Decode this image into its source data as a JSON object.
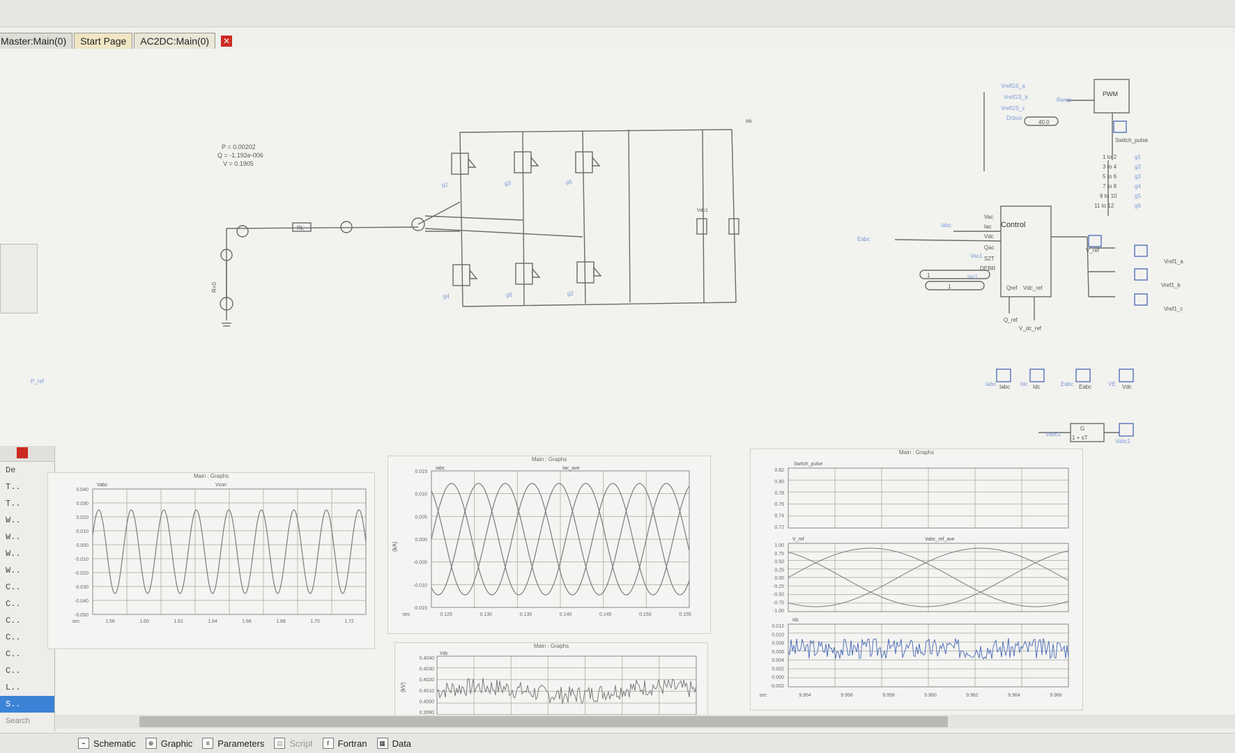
{
  "tabs": [
    "Master:Main(0)",
    "Start Page",
    "AC2DC:Main(0)"
  ],
  "schematic": {
    "pq": [
      "P = 0.00202",
      "Q = -1.192e-006",
      "V = 0.1905"
    ],
    "rl_label": "RL",
    "source_label": "R=0",
    "dc_label": "Vdc1",
    "dc_current": "Idc",
    "gate_labels": [
      "g1",
      "g3",
      "g5",
      "g4",
      "g6",
      "g2"
    ],
    "legs": [
      "2",
      "2",
      "2",
      "2",
      "2",
      "2"
    ],
    "control_block": "Control",
    "control_inputs": [
      "Vac",
      "Iac",
      "Vdc",
      "Qac",
      "S2T",
      "DEBR"
    ],
    "control_outputs": [
      "Qref",
      "Vdc_ref"
    ],
    "control_refs": [
      "Q_ref",
      "V_dc_ref"
    ],
    "control_out_labels": [
      "V_ref",
      "Vref1_a",
      "Vref1_b",
      "Vref1_c"
    ],
    "control_out_right": [
      "Vref1_a",
      "Vref1_b",
      "Vref1_c"
    ],
    "pwm_block": "PWM",
    "pwm_inputs": [
      "VrefGS_a",
      "VrefGS_b",
      "VrefGS_c",
      "Dcbus"
    ],
    "pwm_const": "40.0",
    "pwm_ramp": "Ramp",
    "switch_pulse": "Switch_pulse",
    "switch_map": [
      "1 to 2",
      "3 to 4",
      "5 to 6",
      "7 to 8",
      "9 to 10",
      "11 to 12"
    ],
    "switch_g": [
      "g1",
      "g2",
      "g3",
      "g4",
      "g5",
      "g6"
    ],
    "meters": [
      "Iabc",
      "Idc",
      "Eabc",
      "Vdc"
    ],
    "meter_left": [
      "Iabc",
      "Idc",
      "Eabc",
      "VE"
    ],
    "transfer_fn": {
      "num": "G",
      "den": "1 + sT"
    },
    "tf_in": "Vabc1",
    "tf_out": "Vabc1",
    "labels_misc": [
      "Eabc",
      "Iabc",
      "Vac1",
      "Iac1"
    ],
    "consts": [
      "1",
      "1"
    ],
    "left_tag": "P_ref"
  },
  "graphs": {
    "g1": {
      "title": "Main : Graphs",
      "traces": [
        "Vabc",
        "Vcon"
      ],
      "yticks": [
        "0.040",
        "0.030",
        "0.020",
        "0.010",
        "0.000",
        "-0.010",
        "-0.020",
        "-0.030",
        "-0.040",
        "-0.050"
      ],
      "xticks": [
        "sec",
        "1.58",
        "1.60",
        "1.62",
        "1.64",
        "1.66",
        "1.68",
        "1.70",
        "1.72"
      ]
    },
    "g2": {
      "title": "Main : Graphs",
      "traces": [
        "Iabc",
        "Iac_ave"
      ],
      "ylabel": "(kA)",
      "yticks": [
        "0.015",
        "0.010",
        "0.005",
        "0.000",
        "-0.005",
        "-0.010",
        "-0.015"
      ],
      "xticks": [
        "sec",
        "0.125",
        "0.130",
        "0.135",
        "0.140",
        "0.145",
        "0.150",
        "0.155"
      ]
    },
    "g3": {
      "title": "Main : Graphs",
      "traces": [
        "Vdc"
      ],
      "ylabel": "(kV)",
      "yticks": [
        "0.4040",
        "0.4030",
        "0.4020",
        "0.4010",
        "0.4000",
        "0.3990"
      ]
    },
    "g4": {
      "title": "Main : Graphs",
      "p1_trace": "Switch_pulse",
      "p1_yticks": [
        "0.82",
        "0.80",
        "0.78",
        "0.76",
        "0.74",
        "0.72"
      ],
      "p2_traces": [
        "V_ref",
        "Vabc_ref_ave"
      ],
      "p2_yticks": [
        "1.00",
        "0.75",
        "0.50",
        "0.25",
        "0.00",
        "-0.25",
        "-0.50",
        "-0.75",
        "-1.00"
      ],
      "p3_trace": "Idc",
      "p3_yticks": [
        "0.012",
        "0.010",
        "0.008",
        "0.006",
        "0.004",
        "0.002",
        "0.000",
        "-0.002"
      ],
      "xticks": [
        "sec",
        "9.954",
        "9.956",
        "9.958",
        "9.960",
        "9.962",
        "9.964",
        "9.966"
      ]
    }
  },
  "left_panel": {
    "header": "De",
    "items": [
      "T..",
      "T..",
      "W..",
      "W..",
      "W..",
      "W..",
      "C..",
      "C..",
      "C..",
      "C..",
      "C..",
      "C..",
      "L..",
      "S.."
    ],
    "search": "Search"
  },
  "bottom_tabs": [
    "Schematic",
    "Graphic",
    "Parameters",
    "Script",
    "Fortran",
    "Data"
  ],
  "colors": {
    "wire": "#6a6a6a",
    "blue": "#3a5db0",
    "light_blue": "#7a9ad6",
    "tab_close": "#cc2a22",
    "selected": "#3b83d6"
  }
}
